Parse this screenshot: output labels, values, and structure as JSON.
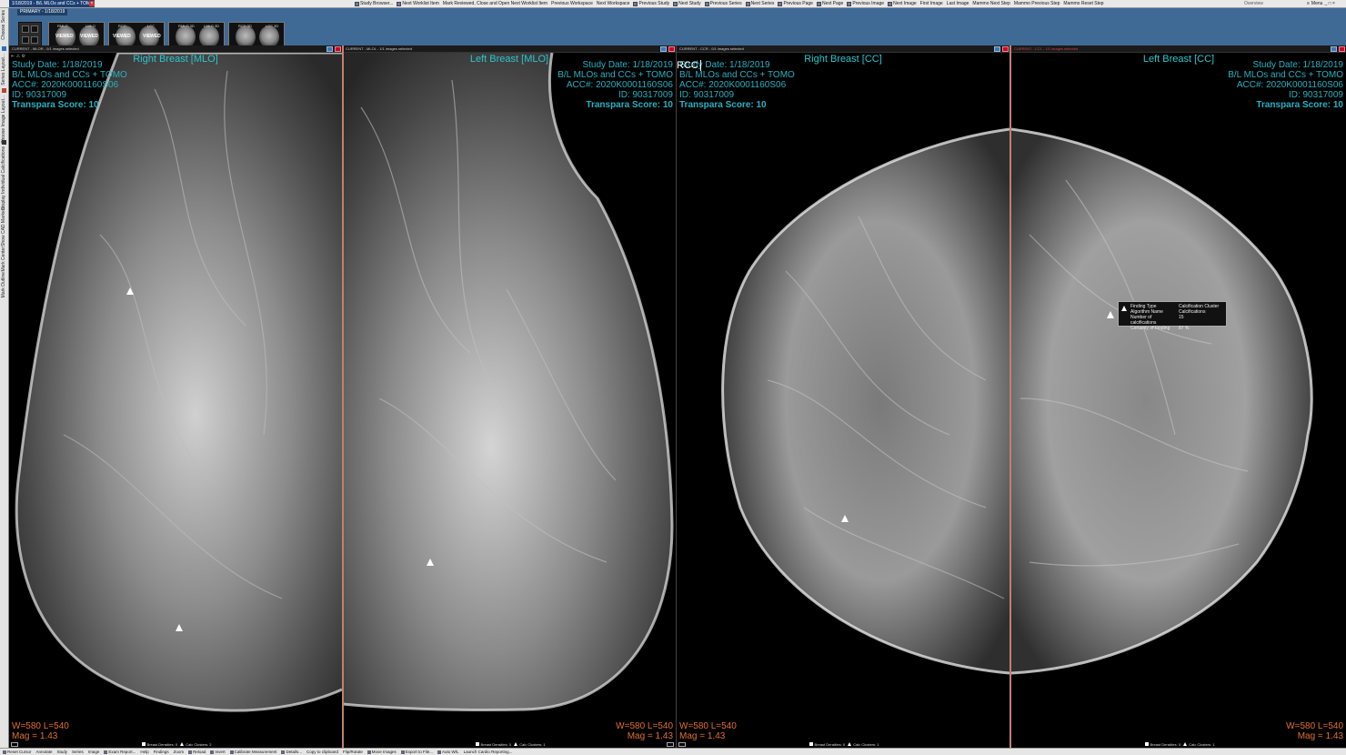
{
  "window": {
    "tab_title": "1/18/2019 - B/L MLOs and CCs + TOMO"
  },
  "toolbar": {
    "commands": [
      "Study Browser...",
      "Next Worklist Item",
      "Mark Reviewed, Close and Open Next Worklist Item",
      "Previous Workspace",
      "Next Workspace",
      "Previous Study",
      "Next Study",
      "Previous Series",
      "Next Series",
      "Previous Page",
      "Next Page",
      "Previous Image",
      "Next Image",
      "First Image",
      "Last Image",
      "Mammo Next Step",
      "Mammo Previous Step",
      "Mammo Reset Step"
    ],
    "overview_label": "Overview",
    "menu_label": "Menu"
  },
  "left_sidebar": {
    "items": [
      "Choose Series",
      "Series Layout...",
      "Choose Image Layout...",
      "Display Individual Calcifications",
      "Show CAD Markers",
      "Mark Center",
      "Mark Outline"
    ]
  },
  "study_strip": {
    "label": "PRIMARY - 1/18/2019",
    "thumbnails": [
      {
        "labels": [
          "RMLO",
          "LMLO"
        ],
        "status": "VIEWED"
      },
      {
        "labels": [
          "RCC",
          "LCC"
        ],
        "status": "VIEWED"
      },
      {
        "labels": [
          "RMLO 3D",
          "LMLO 3D"
        ],
        "status": ""
      },
      {
        "labels": [
          "RCC 3D",
          "LCC 3D"
        ],
        "status": ""
      }
    ]
  },
  "viewports": [
    {
      "header": "CURRENT - MLOR - 0/1 images selected",
      "title": "Right Breast [MLO]",
      "overlay": [
        "Study Date: 1/18/2019",
        "B/L MLOs and CCs + TOMO",
        "ACC#: 2020K0001160S06",
        "ID: 90317009"
      ],
      "score": "Transpara Score: 10",
      "wl": "W=580 L=540",
      "mag": "Mag = 1.43",
      "footer_densities": "Breast Densities: 0",
      "footer_calcs": "Calc Clusters: 2"
    },
    {
      "header": "CURRENT - MLOL - 1/1 images selected",
      "title": "Left Breast [MLO]",
      "overlay": [
        "Study Date: 1/18/2019",
        "B/L MLOs and CCs + TOMO",
        "ACC#: 2020K0001160S06",
        "ID: 90317009"
      ],
      "score": "Transpara Score: 10",
      "wl": "W=580 L=540",
      "mag": "Mag = 1.43",
      "footer_densities": "Breast Densities: 0",
      "footer_calcs": "Calc Clusters: 1"
    },
    {
      "header": "CURRENT - CCR - 0/1 images selected",
      "title": "Right Breast [CC]",
      "overlay": [
        "Study Date: 1/18/2019",
        "B/L MLOs and CCs + TOMO",
        "ACC#: 2020K0001160S06",
        "ID: 90317009"
      ],
      "score": "Transpara Score: 10",
      "wl": "W=580 L=540",
      "mag": "Mag = 1.43",
      "footer_densities": "Breast Densities: 0",
      "footer_calcs": "Calc Clusters: 1",
      "orientation_tag": "RCC"
    },
    {
      "header": "CURRENT - CCL - 1/1 images selected",
      "title": "Left Breast [CC]",
      "overlay": [
        "Study Date: 1/18/2019",
        "B/L MLOs and CCs + TOMO",
        "ACC#: 2020K0001160S06",
        "ID: 90317009"
      ],
      "score": "Transpara Score: 10",
      "wl": "W=580 L=540",
      "mag": "Mag = 1.43",
      "footer_densities": "Breast Densities: 0",
      "footer_calcs": "Calc Clusters: 1"
    }
  ],
  "finding_tooltip": {
    "rows": [
      {
        "key": "Finding Type",
        "value": "Calcification Cluster"
      },
      {
        "key": "Algorithm Name",
        "value": "Calcifications"
      },
      {
        "key": "Number of calcifications",
        "value": "15"
      },
      {
        "key": "Certainty of Finding",
        "value": "87 %"
      }
    ]
  },
  "bottom_toolbar": {
    "items": [
      "Reset Cursor",
      "Annotate",
      "Study",
      "Series",
      "Image",
      "Exam Report...",
      "Help",
      "Findings",
      "Zoom",
      "Reload",
      "Invert",
      "Calibrate Measurement",
      "Details...",
      "Copy to clipboard",
      "Flip/Rotate",
      "Move Images",
      "Export to File...",
      "Auto W/L",
      "Launch Cardio Reporting..."
    ]
  }
}
